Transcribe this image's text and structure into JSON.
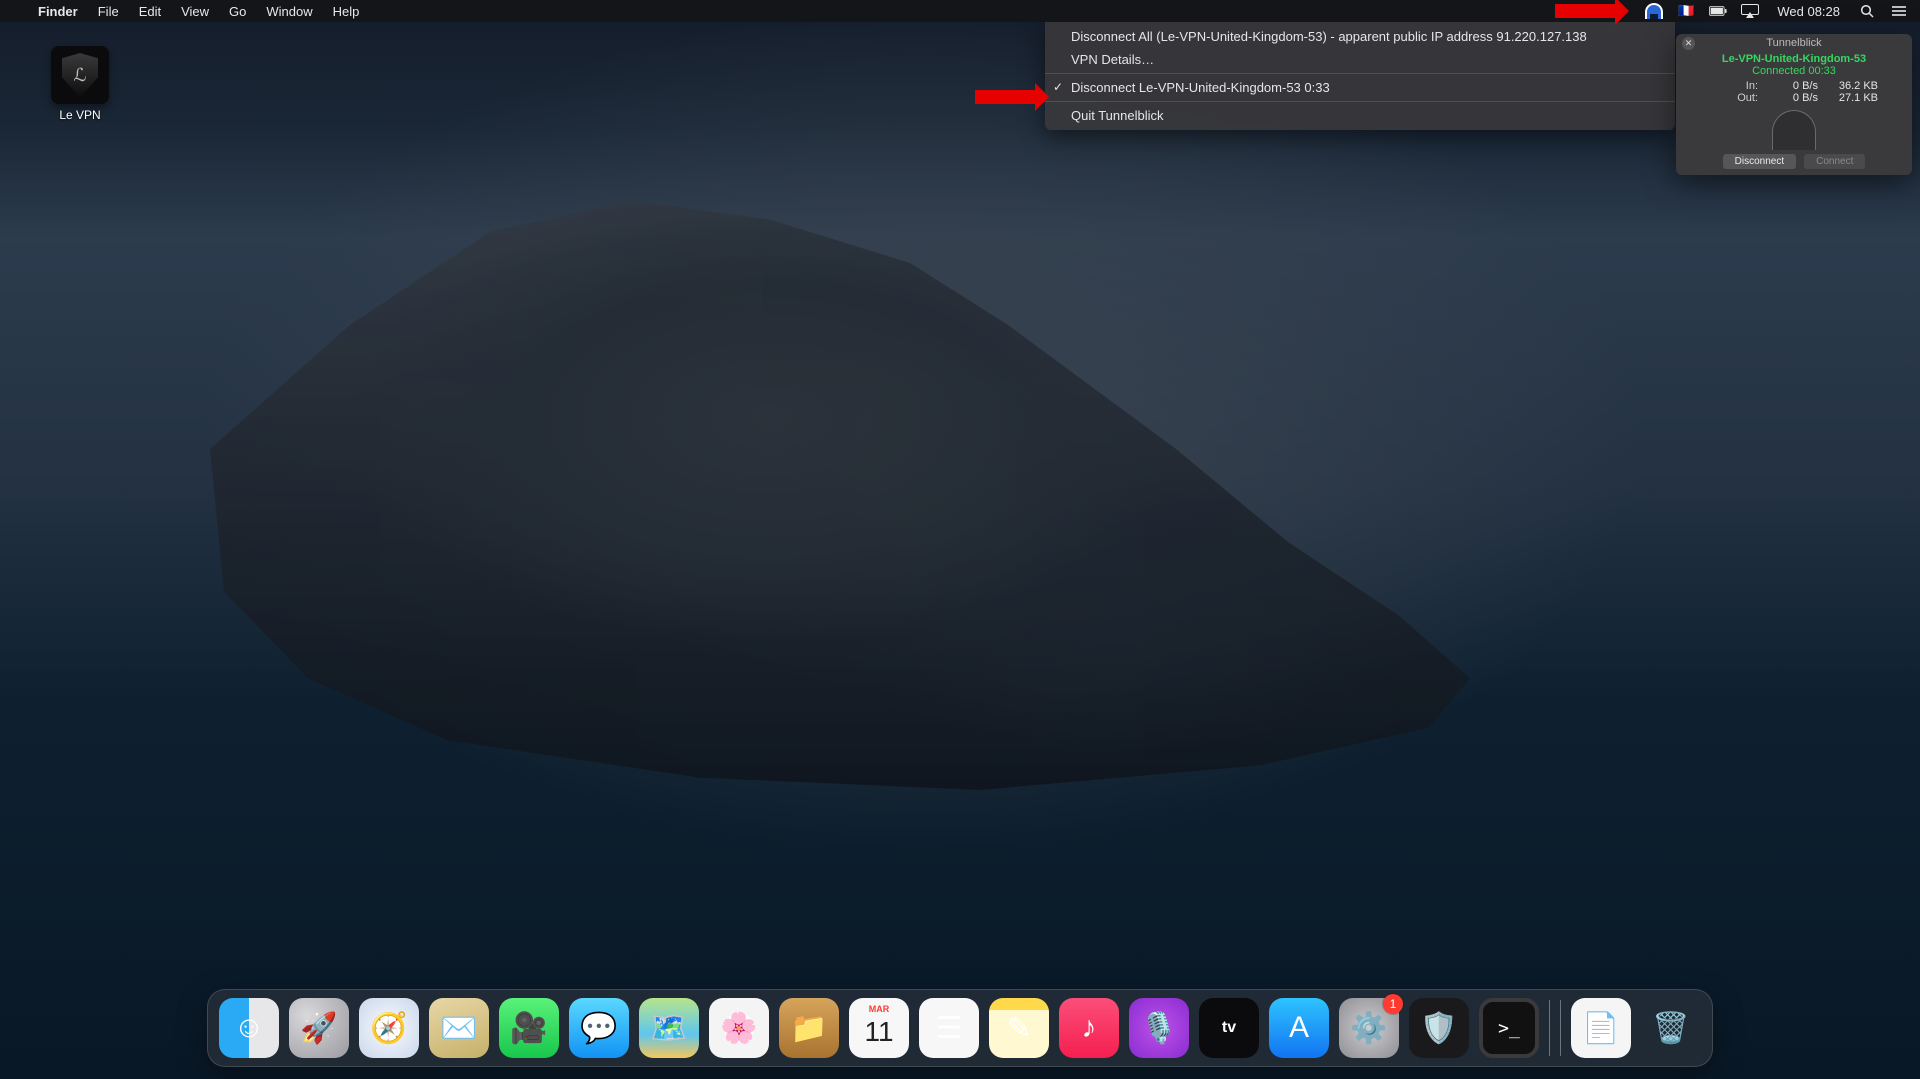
{
  "menubar": {
    "app": "Finder",
    "menus": [
      "File",
      "Edit",
      "View",
      "Go",
      "Window",
      "Help"
    ],
    "clock": "Wed 08:28"
  },
  "dropdown": {
    "disconnect_all": "Disconnect All (Le-VPN-United-Kingdom-53) - apparent public IP address 91.220.127.138",
    "vpn_details": "VPN Details…",
    "disconnect_item": "Disconnect Le-VPN-United-Kingdom-53 0:33",
    "quit": "Quit Tunnelblick"
  },
  "tb_window": {
    "title": "Tunnelblick",
    "conn_name": "Le-VPN-United-Kingdom-53",
    "conn_status": "Connected 00:33",
    "in_label": "In:",
    "out_label": "Out:",
    "in_rate": "0 B/s",
    "in_total": "36.2 KB",
    "out_rate": "0 B/s",
    "out_total": "27.1 KB",
    "btn_disconnect": "Disconnect",
    "btn_connect": "Connect"
  },
  "desktop_icon": {
    "label": "Le VPN"
  },
  "dock": {
    "calendar_month": "MAR",
    "calendar_day": "11",
    "settings_badge": "1",
    "items": [
      {
        "name": "finder",
        "glyph": "☺",
        "cls": "c-finder"
      },
      {
        "name": "launchpad",
        "glyph": "🚀",
        "cls": "c-gray"
      },
      {
        "name": "safari",
        "glyph": "🧭",
        "cls": "c-safari"
      },
      {
        "name": "mail",
        "glyph": "✉️",
        "cls": "c-mail"
      },
      {
        "name": "facetime",
        "glyph": "🎥",
        "cls": "c-facetime"
      },
      {
        "name": "messages",
        "glyph": "💬",
        "cls": "c-messages"
      },
      {
        "name": "maps",
        "glyph": "🗺️",
        "cls": "c-maps"
      },
      {
        "name": "photos",
        "glyph": "🌸",
        "cls": "c-photos"
      },
      {
        "name": "folder",
        "glyph": "📁",
        "cls": "c-folder"
      },
      {
        "name": "calendar",
        "glyph": "",
        "cls": "c-white"
      },
      {
        "name": "reminders",
        "glyph": "☰",
        "cls": "c-white"
      },
      {
        "name": "notes",
        "glyph": "✎",
        "cls": "c-notes"
      },
      {
        "name": "music",
        "glyph": "♪",
        "cls": "c-music"
      },
      {
        "name": "podcasts",
        "glyph": "🎙️",
        "cls": "c-podcasts"
      },
      {
        "name": "tv",
        "glyph": "tv",
        "cls": "c-tv"
      },
      {
        "name": "appstore",
        "glyph": "A",
        "cls": "c-appstore"
      },
      {
        "name": "settings",
        "glyph": "⚙️",
        "cls": "c-settings"
      },
      {
        "name": "levpn",
        "glyph": "🛡️",
        "cls": "c-dark"
      },
      {
        "name": "terminal",
        "glyph": ">_",
        "cls": "c-term"
      },
      {
        "name": "textedit",
        "glyph": "📄",
        "cls": "c-doc"
      },
      {
        "name": "trash",
        "glyph": "🗑️",
        "cls": "c-trash"
      }
    ]
  }
}
